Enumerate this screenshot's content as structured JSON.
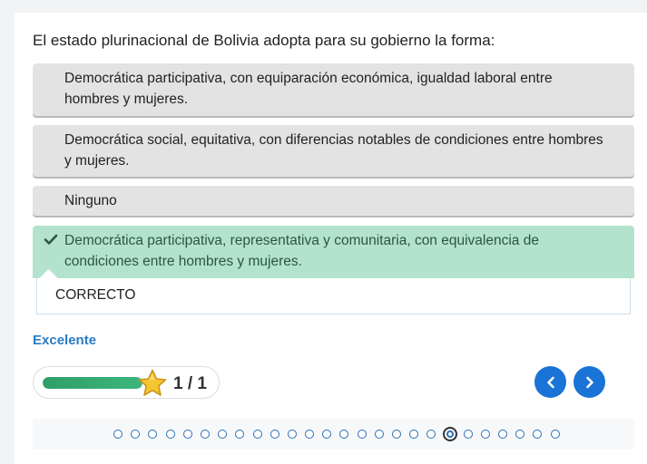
{
  "question": {
    "text": "El estado plurinacional de Bolivia adopta para su gobierno la forma:"
  },
  "options": [
    {
      "label": "Democrática participativa,  con equiparación económica,  igualdad laboral entre hombres y mujeres.",
      "state": "default"
    },
    {
      "label": "Democrática social, equitativa,   con diferencias notables de condiciones entre hombres y mujeres.",
      "state": "default"
    },
    {
      "label": "Ninguno",
      "state": "default"
    },
    {
      "label": "Democrática participativa,  representativa y comunitaria,  con equivalencia de condiciones entre hombres y mujeres.",
      "state": "correct"
    }
  ],
  "feedback": {
    "text": "CORRECTO"
  },
  "result": {
    "text": "Excelente"
  },
  "progress": {
    "fraction": 1.0,
    "score_text": "1 / 1",
    "star_icon": "star-icon"
  },
  "navigation": {
    "prev_icon": "chevron-left-icon",
    "next_icon": "chevron-right-icon"
  },
  "pagination": {
    "total": 26,
    "current_index": 19
  },
  "colors": {
    "correct_bg": "#b3e3cc",
    "option_bg": "#e3e3e3",
    "accent": "#1a73d6",
    "result_text": "#2a7bc1",
    "progress_fill": "#2f9e67"
  }
}
